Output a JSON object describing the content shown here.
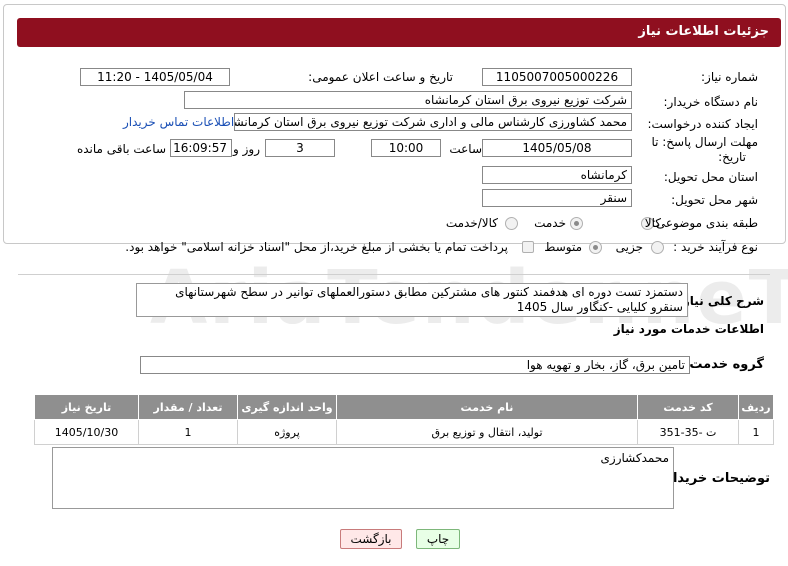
{
  "header": {
    "title": "جزئیات اطلاعات نیاز"
  },
  "fields": {
    "need_number_label": "شماره نیاز:",
    "need_number": "1105007005000226",
    "announce_label": "تاریخ و ساعت اعلان عمومی:",
    "announce_value": "1405/05/04 - 11:20",
    "buyer_org_label": "نام دستگاه خریدار:",
    "buyer_org": "شرکت توزیع نیروی برق استان کرمانشاه",
    "creator_label": "ایجاد کننده درخواست:",
    "creator": "محمد کشاورزی کارشناس مالی و اداری شرکت توزیع نیروی برق استان کرمانشاه",
    "contact_link": "اطلاعات تماس خریدار",
    "deadline_label_1": "مهلت ارسال پاسخ: تا",
    "deadline_label_2": "تاریخ:",
    "deadline_date": "1405/05/08",
    "time_label": "ساعت",
    "deadline_time": "10:00",
    "days_value": "3",
    "days_label": "روز و",
    "remaining_time": "16:09:57",
    "remaining_label": "ساعت باقی مانده",
    "province_label": "استان محل تحویل:",
    "province": "کرمانشاه",
    "city_label": "شهر محل تحویل:",
    "city": "سنقر",
    "category_label": "طبقه بندی موضوعی:",
    "category_options": [
      "کالا",
      "خدمت",
      "کالا/خدمت"
    ],
    "process_label": "نوع فرآیند خرید :",
    "process_options": [
      "جزیی",
      "متوسط"
    ],
    "payment_note": "پرداخت تمام یا بخشی از مبلغ خرید،از محل \"اسناد خزانه اسلامی\" خواهد بود."
  },
  "description": {
    "label": "شرح کلی نیاز:",
    "text": "دستمزد تست دوره ای هدفمند کنتور های مشترکین مطابق دستورالعملهای توانیر در سطح شهرستانهای سنقرو کلیایی -کنگاور سال 1405"
  },
  "services": {
    "section_title": "اطلاعات خدمات مورد نیاز",
    "group_label": "گروه خدمت:",
    "group_value": "تامین برق، گاز، بخار و تهویه هوا",
    "columns": [
      "ردیف",
      "کد خدمت",
      "نام خدمت",
      "واحد اندازه گیری",
      "تعداد / مقدار",
      "تاریخ نیاز"
    ],
    "rows": [
      [
        "1",
        "ت -35-351",
        "تولید، انتقال و توزیع برق",
        "پروژه",
        "1",
        "1405/10/30"
      ]
    ]
  },
  "buyer_notes": {
    "label": "توضیحات خریدار:",
    "text": "محمدکشارزی"
  },
  "buttons": {
    "print": "چاپ",
    "back": "بازگشت"
  },
  "watermark": "AriaTender.neT",
  "colors": {
    "header_bg": "#8f0f1f",
    "table_header_bg": "#8f8f8f",
    "link": "#1a4fb5"
  }
}
